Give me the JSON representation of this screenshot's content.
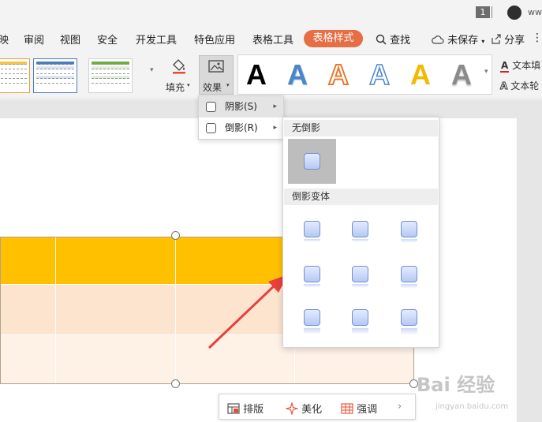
{
  "window": {
    "page_number": "1",
    "user": "ww"
  },
  "menu": {
    "items": [
      "映",
      "审阅",
      "视图",
      "安全",
      "开发工具",
      "特色应用",
      "表格工具"
    ],
    "active": "表格样式",
    "search": "查找",
    "unsaved": "未保存",
    "share": "分享"
  },
  "ribbon": {
    "fill_label": "填充",
    "effect_label": "效果",
    "wordart_letter": "A",
    "wordart_colors": [
      "#000000",
      "#4a86c8",
      "#e87a2f",
      "#4a86c8",
      "#f5b800",
      "#777777"
    ],
    "text_fill_label": "文本填",
    "text_outline_label": "文本轮"
  },
  "effects_menu": {
    "items": [
      {
        "label": "阴影(S)"
      },
      {
        "label": "倒影(R)"
      }
    ]
  },
  "reflection_panel": {
    "none_header": "无倒影",
    "variants_header": "倒影变体"
  },
  "bottom_toolbar": {
    "layout_label": "排版",
    "beautify_label": "美化",
    "emphasis_label": "强调"
  },
  "watermark": {
    "brand": "Bai 经验",
    "url": "jingyan.baidu.com"
  },
  "colors": {
    "accent": "#e76d45",
    "header_row": "#ffc000",
    "row_light": "#fde4cf",
    "row_lighter": "#fef1e6",
    "annotation_arrow": "#e8403c"
  }
}
